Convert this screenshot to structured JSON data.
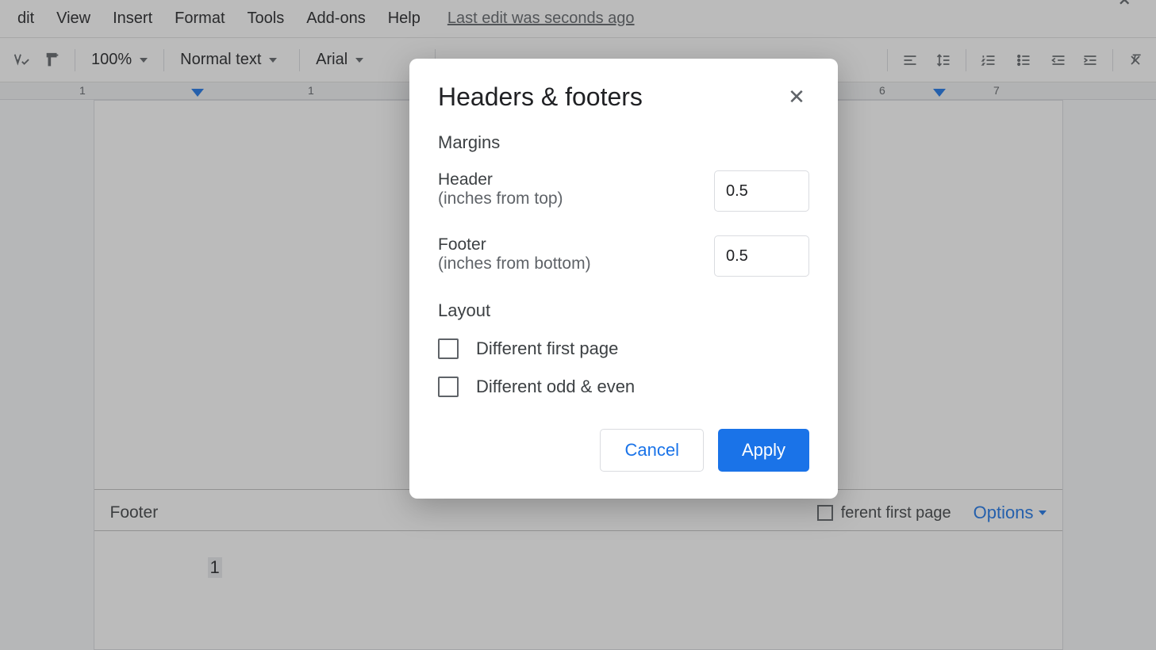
{
  "menubar": {
    "items": [
      "dit",
      "View",
      "Insert",
      "Format",
      "Tools",
      "Add-ons",
      "Help"
    ],
    "last_edit": "Last edit was seconds ago"
  },
  "toolbar": {
    "zoom": "100%",
    "style": "Normal text",
    "font": "Arial"
  },
  "ruler": {
    "ticks": [
      "1",
      "1",
      "6",
      "7"
    ]
  },
  "page": {
    "footer_label": "Footer",
    "diff_first_label": "ferent first page",
    "options_label": "Options",
    "page_number": "1"
  },
  "dialog": {
    "title": "Headers & footers",
    "sections": {
      "margins_head": "Margins",
      "header_label": "Header",
      "header_sub": "(inches from top)",
      "header_value": "0.5",
      "footer_label": "Footer",
      "footer_sub": "(inches from bottom)",
      "footer_value": "0.5",
      "layout_head": "Layout",
      "diff_first": "Different first page",
      "diff_oddeven": "Different odd & even"
    },
    "buttons": {
      "cancel": "Cancel",
      "apply": "Apply"
    }
  }
}
